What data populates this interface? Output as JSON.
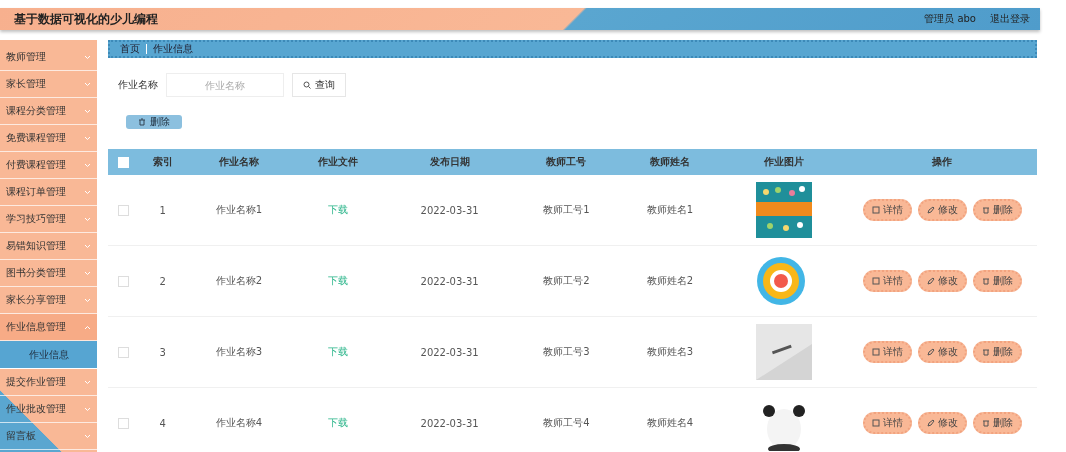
{
  "header": {
    "title": "基于数据可视化的少儿编程",
    "user": "管理员 abo",
    "logout": "退出登录"
  },
  "sidebar": {
    "items": [
      {
        "label": "教师管理",
        "expanded": false
      },
      {
        "label": "家长管理",
        "expanded": false
      },
      {
        "label": "课程分类管理",
        "expanded": false
      },
      {
        "label": "免费课程管理",
        "expanded": false
      },
      {
        "label": "付费课程管理",
        "expanded": false
      },
      {
        "label": "课程订单管理",
        "expanded": false
      },
      {
        "label": "学习技巧管理",
        "expanded": false
      },
      {
        "label": "易错知识管理",
        "expanded": false
      },
      {
        "label": "图书分类管理",
        "expanded": false
      },
      {
        "label": "家长分享管理",
        "expanded": false
      },
      {
        "label": "作业信息管理",
        "expanded": true,
        "children": [
          {
            "label": "作业信息",
            "selected": true
          }
        ]
      },
      {
        "label": "提交作业管理",
        "expanded": false
      },
      {
        "label": "作业批改管理",
        "expanded": false
      },
      {
        "label": "留言板",
        "expanded": false
      }
    ]
  },
  "breadcrumb": [
    "首页",
    "作业信息"
  ],
  "search": {
    "label": "作业名称",
    "placeholder": "作业名称",
    "button": "查询"
  },
  "delete_button": "删除",
  "table": {
    "all_checked": false,
    "columns": [
      "索引",
      "作业名称",
      "作业文件",
      "发布日期",
      "教师工号",
      "教师姓名",
      "作业图片",
      "操作"
    ],
    "rows": [
      {
        "checked": false,
        "index": "1",
        "name": "作业名称1",
        "file": "下载",
        "date": "2022-03-31",
        "teacher_id": "教师工号1",
        "teacher_name": "教师姓名1",
        "picture": {
          "kind": "picture"
        },
        "actions": [
          "详情",
          "修改",
          "删除"
        ]
      },
      {
        "checked": false,
        "index": "2",
        "name": "作业名称2",
        "file": "下载",
        "date": "2022-03-31",
        "teacher_id": "教师工号2",
        "teacher_name": "教师姓名2",
        "picture": {
          "kind": "picture"
        },
        "actions": [
          "详情",
          "修改",
          "删除"
        ]
      },
      {
        "checked": false,
        "index": "3",
        "name": "作业名称3",
        "file": "下载",
        "date": "2022-03-31",
        "teacher_id": "教师工号3",
        "teacher_name": "教师姓名3",
        "picture": {
          "kind": "picture"
        },
        "actions": [
          "详情",
          "修改",
          "删除"
        ]
      },
      {
        "checked": false,
        "index": "4",
        "name": "作业名称4",
        "file": "下载",
        "date": "2022-03-31",
        "teacher_id": "教师工号4",
        "teacher_name": "教师姓名4",
        "picture": {
          "kind": "picture"
        },
        "actions": [
          "详情",
          "修改",
          "删除"
        ]
      }
    ]
  }
}
